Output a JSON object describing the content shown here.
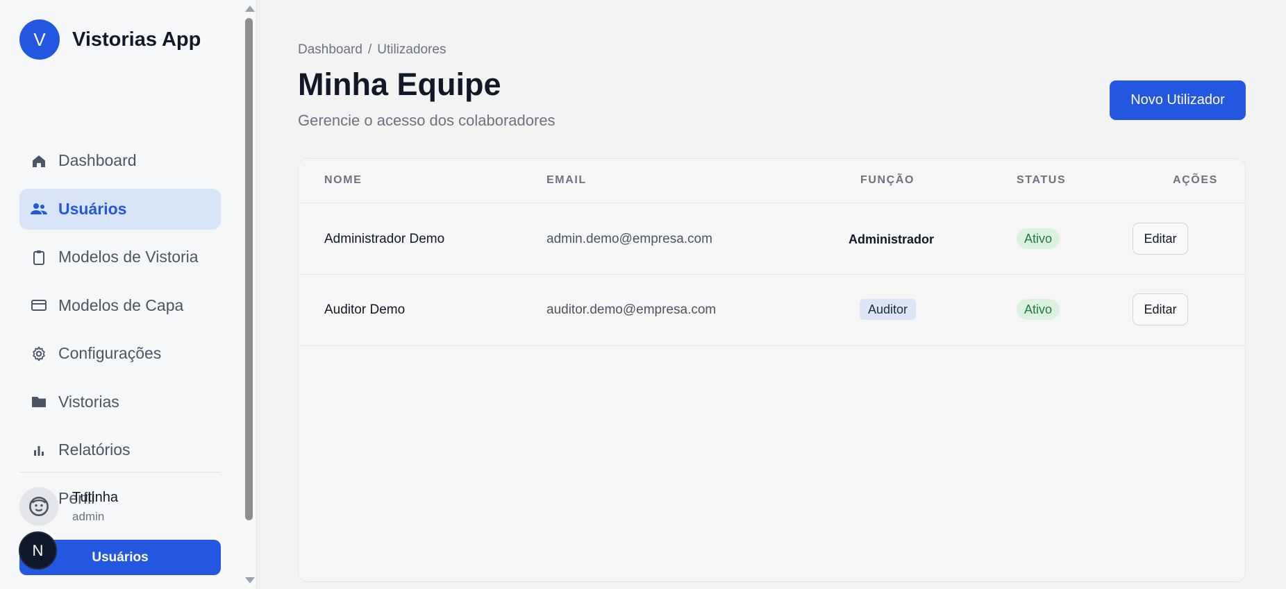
{
  "app": {
    "logo_letter": "V",
    "name": "Vistorias App"
  },
  "sidebar": {
    "items": [
      {
        "label": "Dashboard",
        "icon": "home-icon",
        "active": false
      },
      {
        "label": "Usuários",
        "icon": "users-icon",
        "active": true
      },
      {
        "label": "Modelos de Vistoria",
        "icon": "clipboard-icon",
        "active": false
      },
      {
        "label": "Modelos de Capa",
        "icon": "card-icon",
        "active": false
      },
      {
        "label": "Configurações",
        "icon": "gear-icon",
        "active": false
      },
      {
        "label": "Vistorias",
        "icon": "folder-icon",
        "active": false
      },
      {
        "label": "Relatórios",
        "icon": "bar-chart-icon",
        "active": false
      },
      {
        "label": "Perfil",
        "icon": "face-icon",
        "active": false
      }
    ],
    "user": {
      "name": "Tutinha",
      "role": "admin"
    },
    "bottom_button_label": "Usuários",
    "floating_avatar_letter": "N"
  },
  "main": {
    "breadcrumb": [
      "Dashboard",
      "Utilizadores"
    ],
    "breadcrumb_separator": "/",
    "title": "Minha Equipe",
    "subtitle": "Gerencie o acesso dos colaboradores",
    "new_button_label": "Novo Utilizador",
    "table": {
      "headers": {
        "name": "NOME",
        "email": "EMAIL",
        "role": "FUNÇÃO",
        "status": "STATUS",
        "actions": "AÇÕES"
      },
      "rows": [
        {
          "name": "Administrador Demo",
          "email": "admin.demo@empresa.com",
          "role": "Administrador",
          "role_style": "bold",
          "status": "Ativo",
          "action": "Editar"
        },
        {
          "name": "Auditor Demo",
          "email": "auditor.demo@empresa.com",
          "role": "Auditor",
          "role_style": "badge",
          "status": "Ativo",
          "action": "Editar"
        }
      ]
    }
  },
  "colors": {
    "accent": "#2457e0",
    "active_nav_bg": "#d8e4f8",
    "status_bg": "#dcf2e1",
    "status_text": "#1f7a3a",
    "role_badge_bg": "#dbe5f6"
  }
}
